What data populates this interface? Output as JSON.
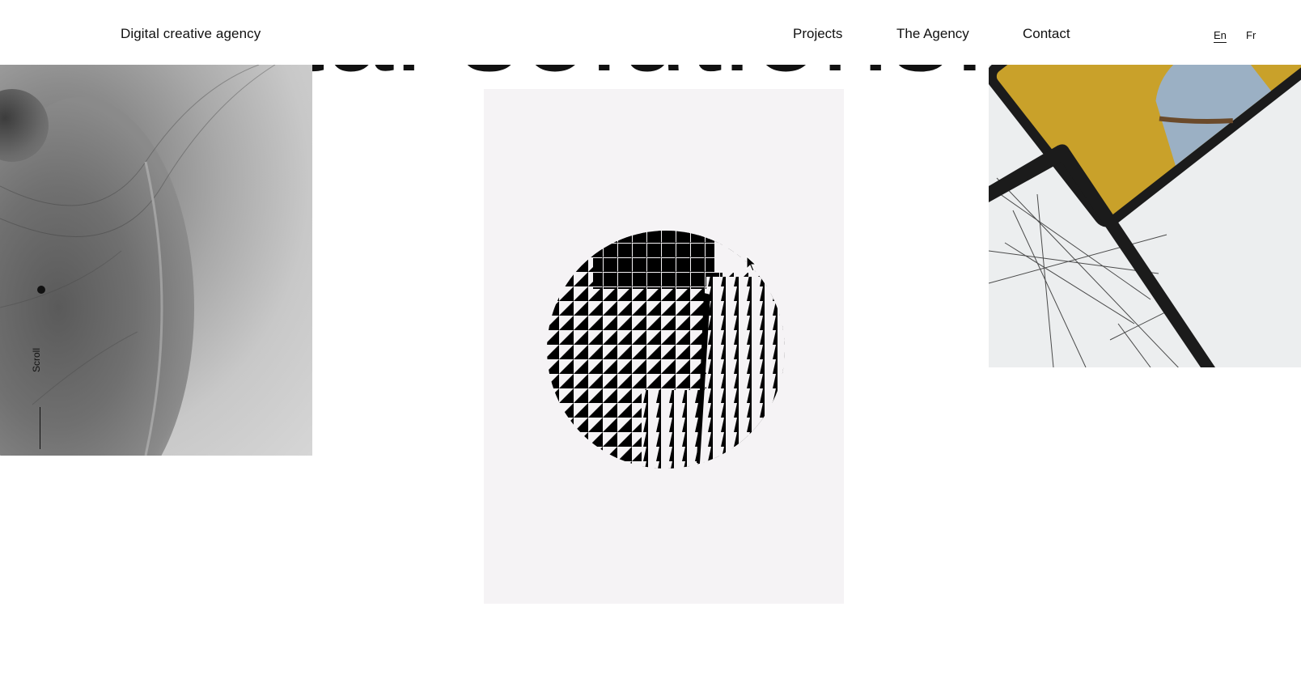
{
  "header": {
    "brand": "Digital creative agency",
    "nav": [
      "Projects",
      "The Agency",
      "Contact"
    ],
    "languages": {
      "en": "En",
      "fr": "Fr",
      "active": "En"
    }
  },
  "hero": {
    "headline": "digital solutions."
  },
  "scroll": {
    "label": "Scroll"
  },
  "icons": {
    "cursor": "arrow-cursor-icon",
    "scroll_dot": "scroll-dot-icon"
  },
  "colors": {
    "text": "#111111",
    "background": "#ffffff",
    "center_panel": "#f5f3f5",
    "accent_yellow": "#c9a12a"
  }
}
